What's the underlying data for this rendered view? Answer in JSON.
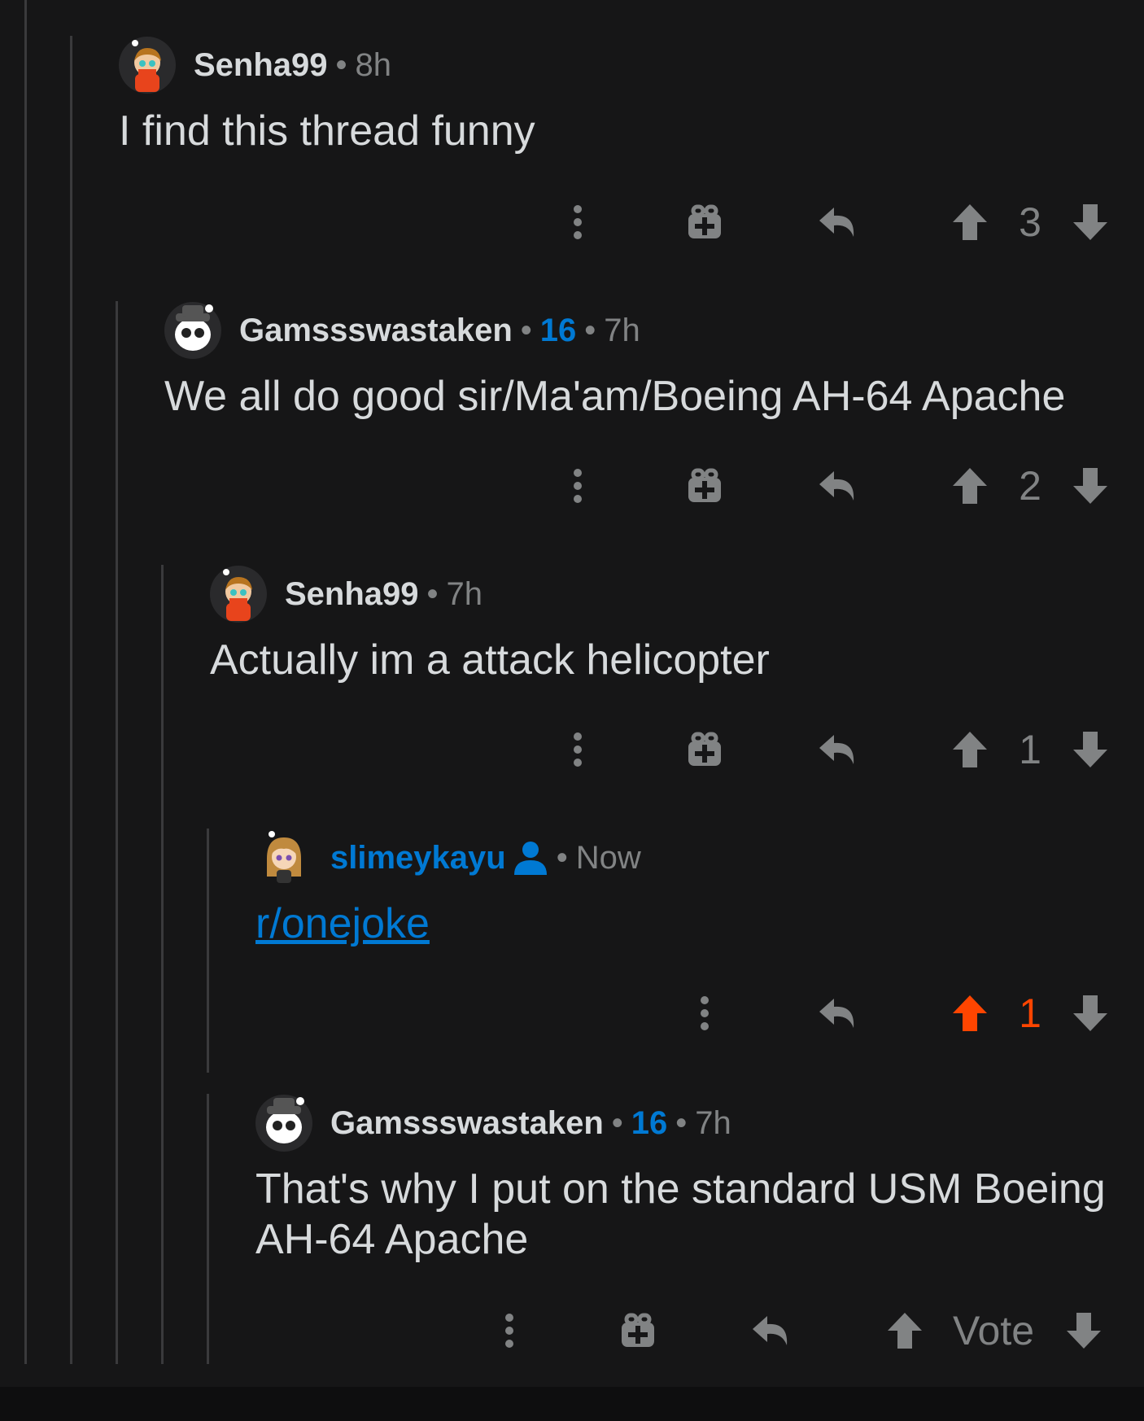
{
  "colors": {
    "background": "#161617",
    "text": "#d7dadc",
    "meta": "#818384",
    "link_blue": "#0079d3",
    "upvote_orange": "#ff4500",
    "thread_line": "#3a3a3c"
  },
  "comments": [
    {
      "username": "Senha99",
      "flair": "",
      "time": "8h",
      "body": "I find this thread funny",
      "votes": "3",
      "upvoted": false,
      "has_award": true,
      "avatar_icon": "senha-avatar-icon"
    },
    {
      "username": "Gamssswastaken",
      "flair": "16",
      "time": "7h",
      "body": "We all do good sir/Ma'am/Boeing AH-64 Apache",
      "votes": "2",
      "upvoted": false,
      "has_award": true,
      "avatar_icon": "gams-avatar-icon"
    },
    {
      "username": "Senha99",
      "flair": "",
      "time": "7h",
      "body": "Actually im a attack helicopter",
      "votes": "1",
      "upvoted": false,
      "has_award": true,
      "avatar_icon": "senha-avatar-icon"
    },
    {
      "username": "slimeykayu",
      "flair": "",
      "time": "Now",
      "body": "r/onejoke",
      "body_is_link": true,
      "is_self": true,
      "votes": "1",
      "upvoted": true,
      "has_award": false,
      "avatar_icon": "slimey-avatar-icon"
    },
    {
      "username": "Gamssswastaken",
      "flair": "16",
      "time": "7h",
      "body_lines": [
        "That's why I put on the standard USM Boeing",
        "AH-64 Apache"
      ],
      "votes": "Vote",
      "upvoted": false,
      "has_award": true,
      "avatar_icon": "gams-avatar-icon"
    }
  ],
  "separator": "•"
}
